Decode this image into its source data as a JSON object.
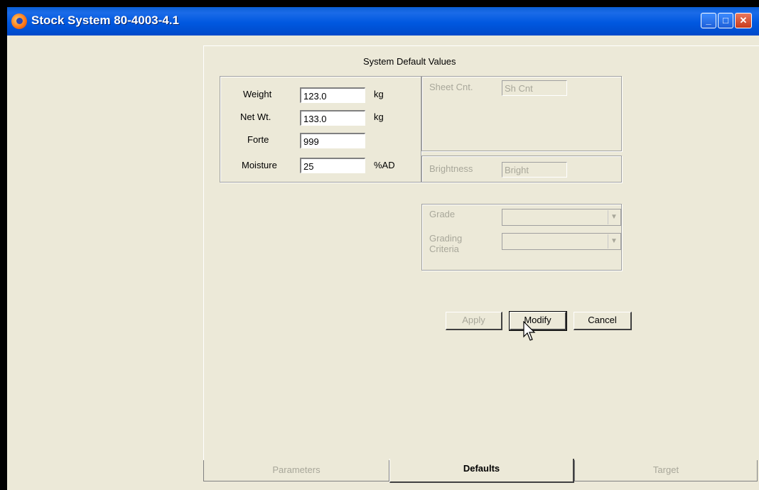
{
  "window": {
    "title": "Stock System 80-4003-4.1",
    "controls": {
      "minimize": "_",
      "maximize": "□",
      "close": "✕"
    }
  },
  "panel": {
    "title": "System Default Values"
  },
  "fields": {
    "weight": {
      "label": "Weight",
      "value": "123.0",
      "unit": "kg"
    },
    "net_wt": {
      "label": "Net Wt.",
      "value": "133.0",
      "unit": "kg"
    },
    "forte": {
      "label": "Forte",
      "value": "999"
    },
    "moisture": {
      "label": "Moisture",
      "value": "25",
      "unit": "%AD"
    },
    "sheet_cnt": {
      "label": "Sheet Cnt.",
      "value": "Sh Cnt"
    },
    "brightness": {
      "label": "Brightness",
      "value": "Bright"
    },
    "grade": {
      "label": "Grade",
      "value": ""
    },
    "grading_criteria": {
      "label_line1": "Grading",
      "label_line2": "Criteria",
      "value": ""
    }
  },
  "buttons": {
    "apply": "Apply",
    "modify": "Modify",
    "cancel": "Cancel"
  },
  "tabs": [
    {
      "label": "Parameters",
      "state": "inactive"
    },
    {
      "label": "Defaults",
      "state": "active"
    },
    {
      "label": "Target",
      "state": "inactive"
    }
  ],
  "icons": {
    "app": "app-icon",
    "dropdown": "chevron-down-icon",
    "cursor": "mouse-pointer-icon"
  },
  "colors": {
    "titlebar": "#0058e0",
    "face": "#ece9d8",
    "disabled_text": "#a8a79a"
  }
}
